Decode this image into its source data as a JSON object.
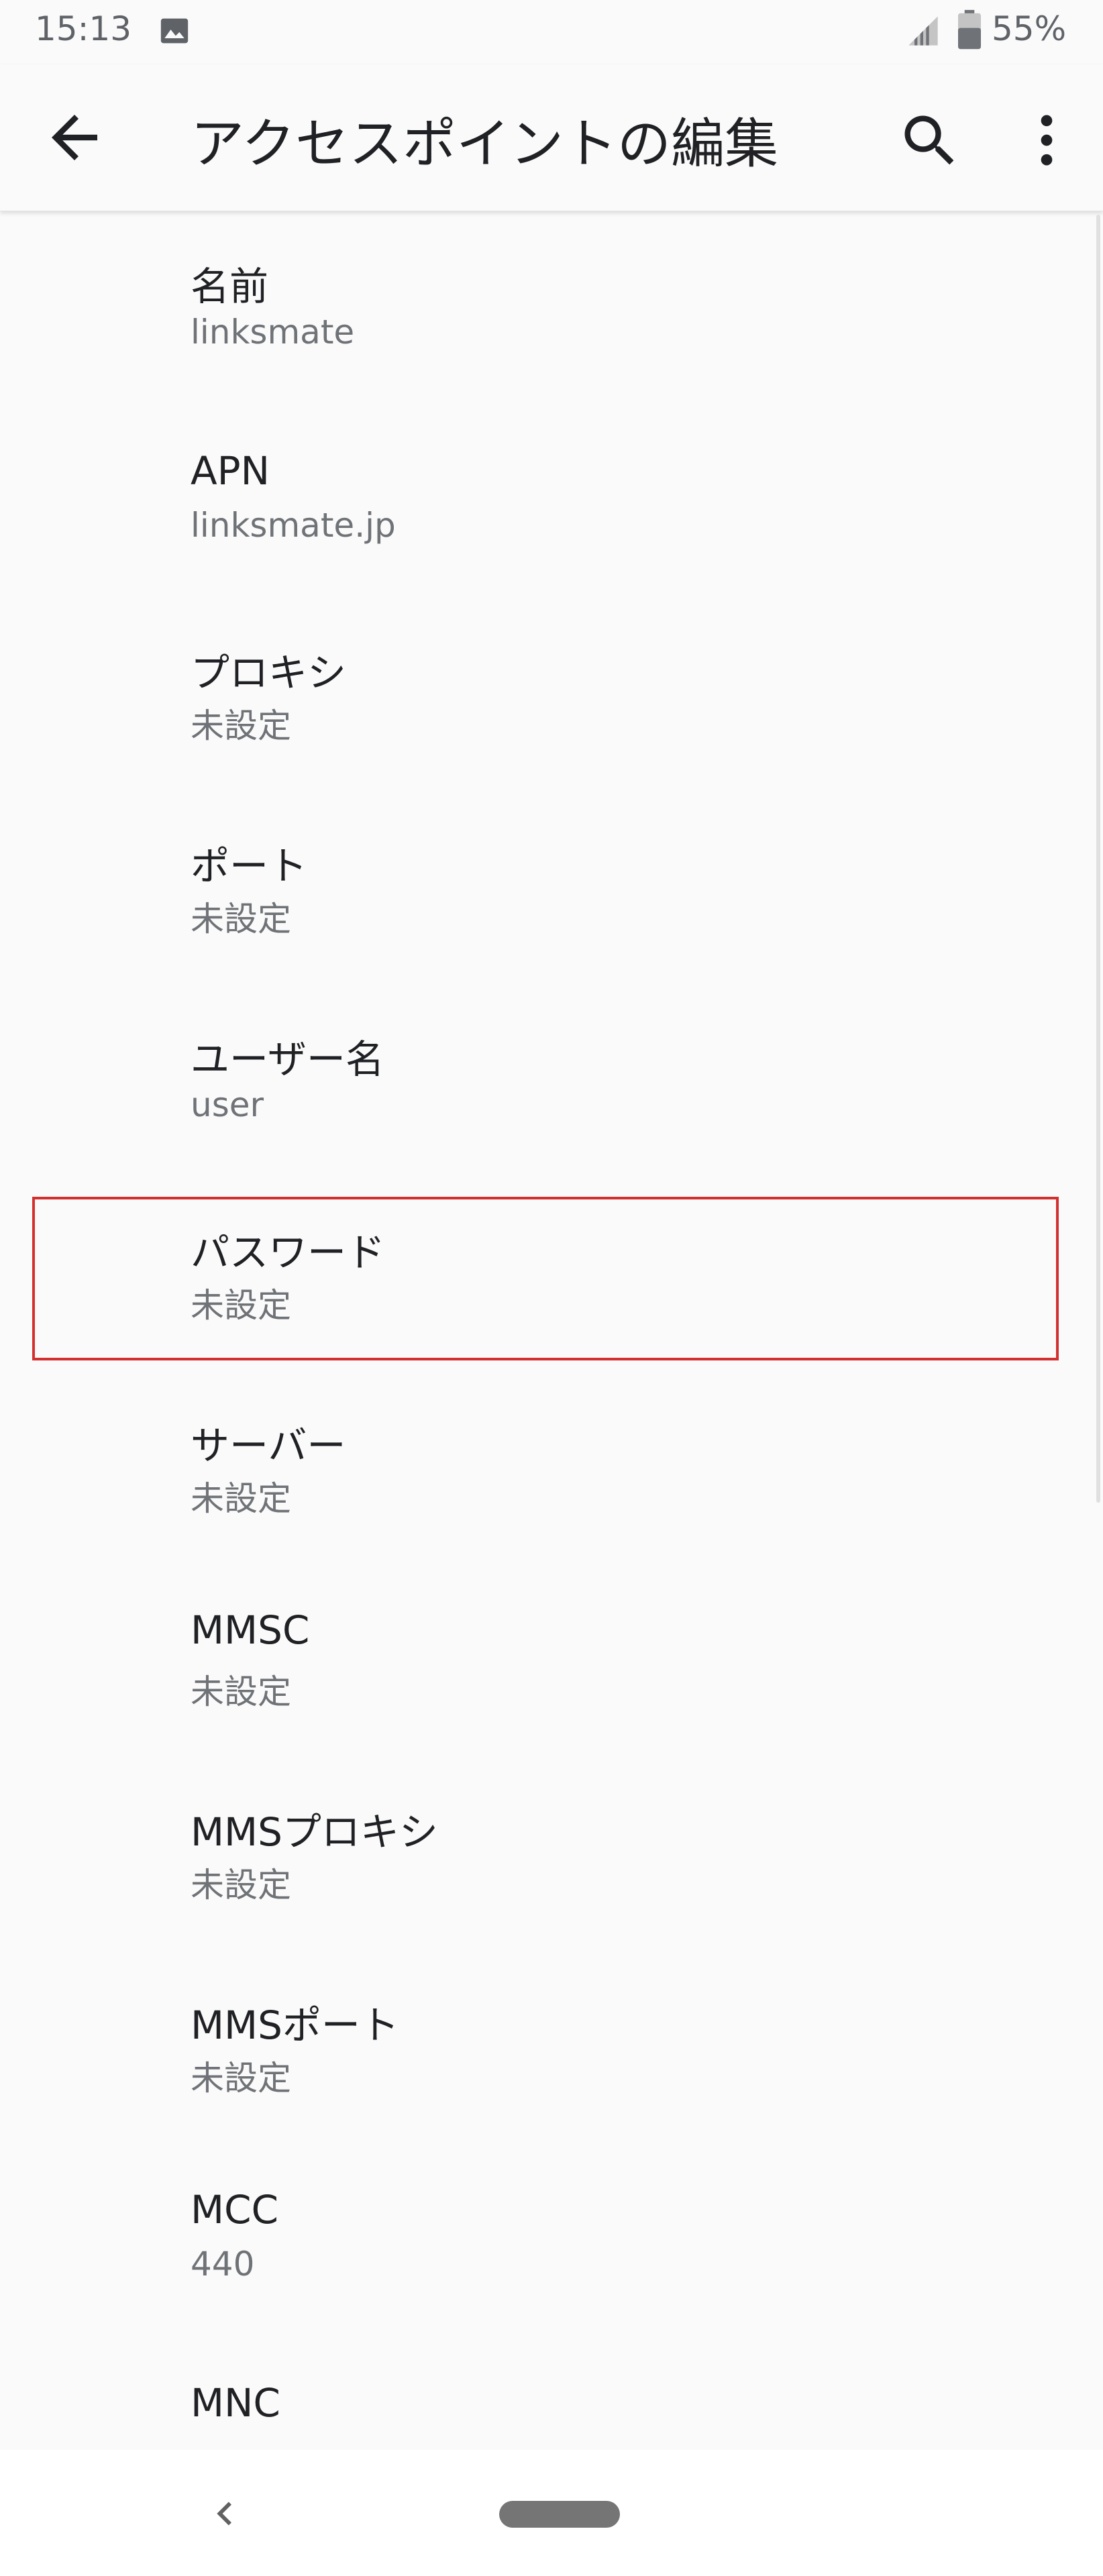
{
  "status_bar": {
    "time": "15:13",
    "battery": "55%",
    "icons": [
      "image-icon",
      "signal-icon",
      "battery-icon"
    ]
  },
  "app_bar": {
    "title": "アクセスポイントの編集",
    "icons": [
      "back-arrow-icon",
      "search-icon",
      "more-vert-icon"
    ]
  },
  "preferences": [
    {
      "title": "名前",
      "summary": "linksmate"
    },
    {
      "title": "APN",
      "summary": "linksmate.jp"
    },
    {
      "title": "プロキシ",
      "summary": "未設定"
    },
    {
      "title": "ポート",
      "summary": "未設定"
    },
    {
      "title": "ユーザー名",
      "summary": "user"
    },
    {
      "title": "パスワード",
      "summary": "未設定"
    },
    {
      "title": "サーバー",
      "summary": "未設定"
    },
    {
      "title": "MMSC",
      "summary": "未設定"
    },
    {
      "title": "MMSプロキシ",
      "summary": "未設定"
    },
    {
      "title": "MMSポート",
      "summary": "未設定"
    },
    {
      "title": "MCC",
      "summary": "440"
    },
    {
      "title": "MNC",
      "summary": ""
    }
  ],
  "colors": {
    "highlight": "#d32f2f",
    "background": "#fafafa",
    "title_text": "#202124",
    "summary_text": "#6f7276"
  }
}
